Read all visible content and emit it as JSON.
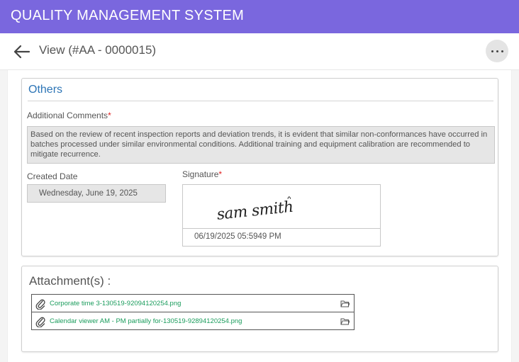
{
  "header": {
    "app_title": "QUALITY MANAGEMENT SYSTEM",
    "accent_color": "#7a67de"
  },
  "subheader": {
    "view_title": "View (#AA - 0000015)",
    "back_icon": "arrow-left-icon",
    "menu_icon": "more-horizontal-icon"
  },
  "others": {
    "section_title": "Others",
    "comments_label": "Additional Comments",
    "comments_required": "*",
    "comments_value": "Based on the review of recent inspection reports and deviation trends, it is evident that similar non-conformances have occurred in batches processed under similar environmental conditions. Additional training and equipment calibration are recommended to mitigate recurrence.",
    "created_label": "Created Date",
    "created_value": "Wednesday, June 19, 2025",
    "signature_label": "Signature",
    "signature_required": "*",
    "signature_text": "sam smith",
    "signature_stamp": "06/19/2025 05:5949 PM"
  },
  "attachments": {
    "title": "Attachment(s) :",
    "items": [
      {
        "name": "Corporate time 3-130519-92094120254.png",
        "icon": "paperclip-icon",
        "action_icon": "folder-open-icon"
      },
      {
        "name": "Calendar viewer AM - PM partially for-130519-92894120254.png",
        "icon": "paperclip-icon",
        "action_icon": "folder-open-icon"
      }
    ],
    "link_color": "#1a9c5c"
  }
}
